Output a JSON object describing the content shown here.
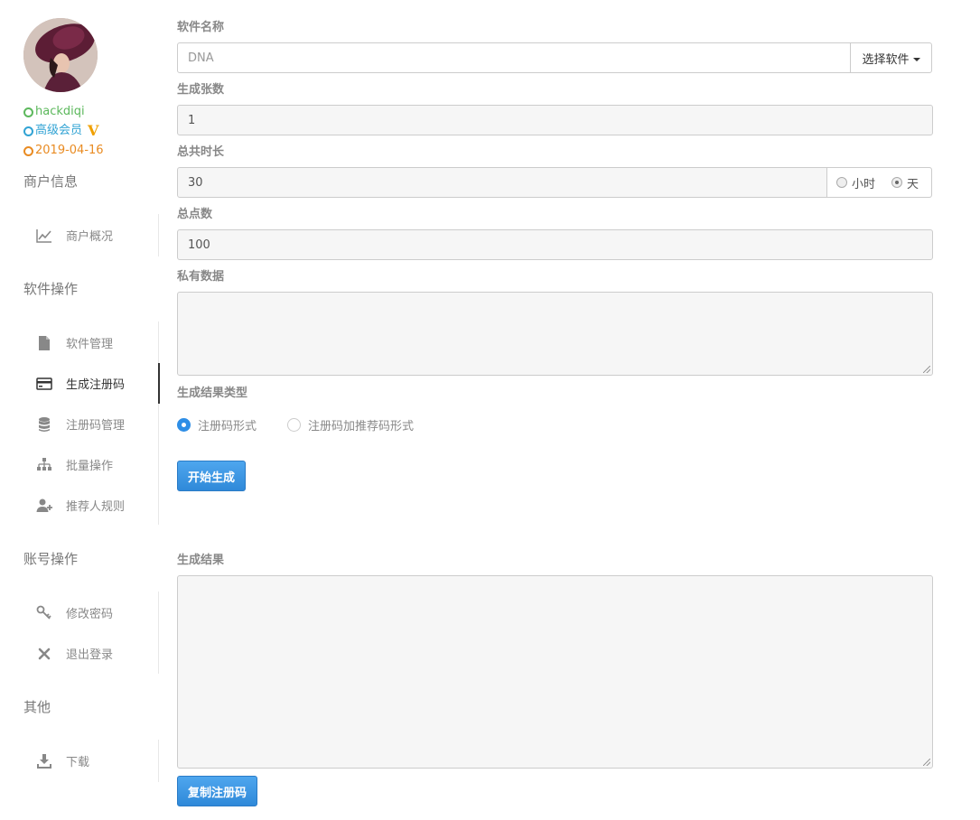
{
  "user": {
    "name": "hackdiqi",
    "level": "高级会员",
    "vip_mark": "V",
    "date": "2019-04-16"
  },
  "sidebar": {
    "sections": [
      {
        "title": "商户信息",
        "items": [
          {
            "label": "商户概况",
            "icon": "chart-line-icon"
          }
        ]
      },
      {
        "title": "软件操作",
        "items": [
          {
            "label": "软件管理",
            "icon": "file-icon"
          },
          {
            "label": "生成注册码",
            "icon": "credit-card-icon"
          },
          {
            "label": "注册码管理",
            "icon": "database-icon"
          },
          {
            "label": "批量操作",
            "icon": "sitemap-icon"
          },
          {
            "label": "推荐人规则",
            "icon": "user-plus-icon"
          }
        ]
      },
      {
        "title": "账号操作",
        "items": [
          {
            "label": "修改密码",
            "icon": "key-icon"
          },
          {
            "label": "退出登录",
            "icon": "close-icon"
          }
        ]
      },
      {
        "title": "其他",
        "items": [
          {
            "label": "下载",
            "icon": "download-icon"
          }
        ]
      }
    ],
    "active_item": "生成注册码"
  },
  "form": {
    "software_label": "软件名称",
    "software_value": "DNA",
    "select_software_button": "选择软件",
    "count_label": "生成张数",
    "count_value": "1",
    "duration_label": "总共时长",
    "duration_value": "30",
    "unit_hour": "小时",
    "unit_day": "天",
    "unit_selected": "天",
    "points_label": "总点数",
    "points_value": "100",
    "private_label": "私有数据",
    "private_value": "",
    "result_type_label": "生成结果类型",
    "result_type_option1": "注册码形式",
    "result_type_option2": "注册码加推荐码形式",
    "result_type_selected": "注册码形式",
    "generate_button": "开始生成",
    "result_label": "生成结果",
    "result_value": "",
    "copy_button": "复制注册码"
  },
  "colors": {
    "accent": "#2e8ee6",
    "username": "#5cb85c",
    "level": "#31a3d4",
    "date": "#e98b22",
    "vip": "#f0a000"
  }
}
